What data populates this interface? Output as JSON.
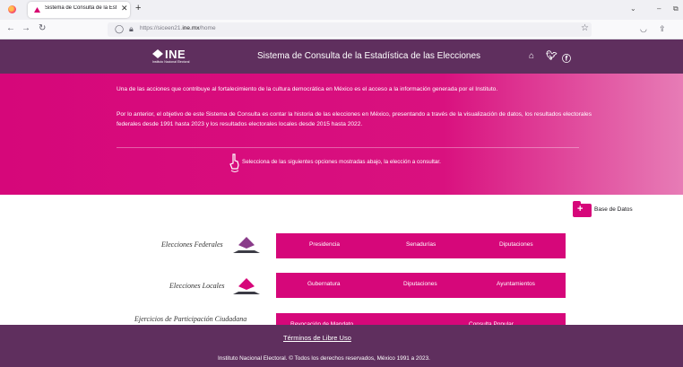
{
  "browser": {
    "tab_title": "Sistema de Consulta de la Estad",
    "tab_close": "✕",
    "new_tab": "+",
    "url_prefix": "https://siceen21.",
    "url_domain": "ine.mx",
    "url_path": "/home",
    "back": "←",
    "forward": "→",
    "reload": "↻",
    "star": "☆",
    "win_down": "⌄",
    "win_min": "–",
    "win_max": "⧉"
  },
  "header": {
    "logo_word": "INE",
    "logo_sub": "Instituto Nacional Electoral",
    "title": "Sistema de Consulta de la Estadística de las Elecciones",
    "icons": [
      "home-icon",
      "twitter-icon",
      "facebook-icon"
    ]
  },
  "hero": {
    "paragraph1": "Una de las acciones que contribuye al fortalecimiento de la cultura democrática en México es el acceso a la información generada por el Instituto.",
    "paragraph2": "Por lo anterior, el objetivo de este Sistema de Consulta es contar la historia de las elecciones en México, presentando a través de la visualización de datos, los resultados electorales federales desde 1991 hasta 2023 y los resultados electorales locales desde 2015 hasta 2022.",
    "hint": "Selecciona de las siguientes opciones mostradas abajo, la elección a consultar."
  },
  "main": {
    "db_label": "Base de Datos",
    "federal": {
      "label": "Elecciones Federales",
      "options": [
        "Presidencia",
        "Senadurías",
        "Diputaciones"
      ]
    },
    "local": {
      "label": "Elecciones Locales",
      "options": [
        "Gubernatura",
        "Diputaciones",
        "Ayuntamientos"
      ]
    },
    "participation": {
      "label": "Ejercicios de Participación Ciudadana",
      "options": [
        "Revocación de Mandato",
        "Consulta Popular"
      ]
    }
  },
  "footer": {
    "terms": "Términos de Libre Uso",
    "copyright": "Instituto Nacional Electoral. © Todos los derechos reservados, México 1991 a 2023."
  },
  "colors": {
    "header_purple": "#5f2f5e",
    "brand_pink": "#d6077a",
    "federal_diamond": "#8a3c8a",
    "local_diamond": "#d6077a"
  }
}
